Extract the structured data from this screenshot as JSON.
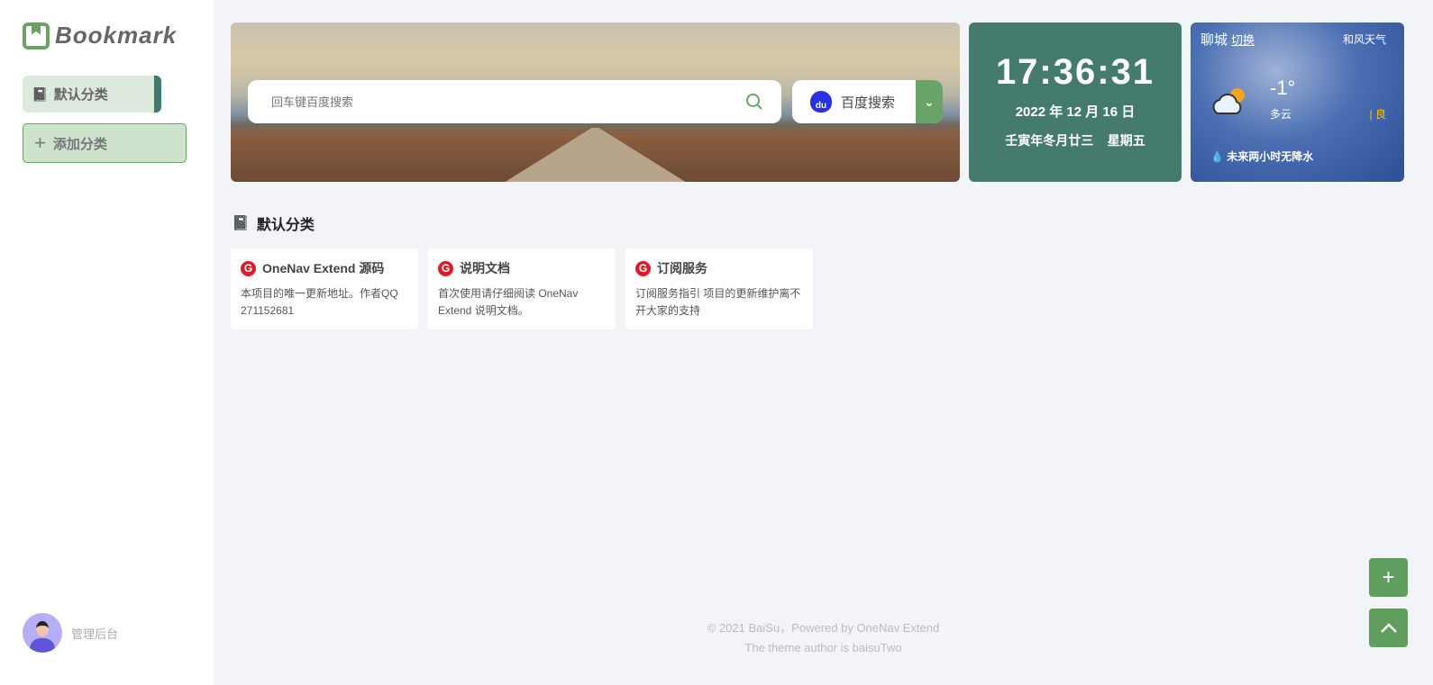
{
  "sidebar": {
    "logo_text": "Bookmark",
    "categories": [
      {
        "label": "默认分类"
      }
    ],
    "add_category": "添加分类",
    "admin_label": "管理后台"
  },
  "search": {
    "placeholder": "回车键百度搜索",
    "engine": "百度搜索",
    "engine_icon_text": "du"
  },
  "clock": {
    "time": "17:36:31",
    "date": "2022 年 12 月 16 日",
    "lunar": "壬寅年冬月廿三",
    "weekday": "星期五"
  },
  "weather": {
    "city": "聊城",
    "switch": "切换",
    "source": "和风天气",
    "temp": "-1°",
    "desc": "多云",
    "aqi": "良",
    "forecast": "未来两小时无降水"
  },
  "section": {
    "title": "默认分类"
  },
  "links": [
    {
      "title": "OneNav Extend 源码",
      "desc": "本项目的唯一更新地址。作者QQ 271152681"
    },
    {
      "title": "说明文档",
      "desc": "首次使用请仔细阅读 OneNav Extend 说明文档。"
    },
    {
      "title": "订阅服务",
      "desc": "订阅服务指引 项目的更新维护离不开大家的支持"
    }
  ],
  "footer": {
    "line1": "© 2021 BaiSu，Powered by OneNav Extend",
    "line2": "The theme author is baisuTwo"
  },
  "colors": {
    "accent": "#6aa368",
    "clock_bg": "#457a6f"
  }
}
